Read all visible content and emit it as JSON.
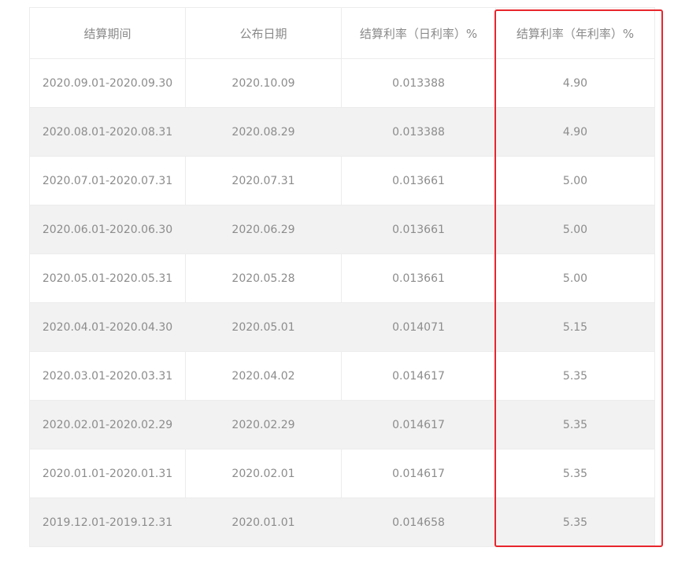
{
  "table": {
    "headers": [
      "结算期间",
      "公布日期",
      "结算利率（日利率）%",
      "结算利率（年利率）%"
    ],
    "rows": [
      [
        "2020.09.01-2020.09.30",
        "2020.10.09",
        "0.013388",
        "4.90"
      ],
      [
        "2020.08.01-2020.08.31",
        "2020.08.29",
        "0.013388",
        "4.90"
      ],
      [
        "2020.07.01-2020.07.31",
        "2020.07.31",
        "0.013661",
        "5.00"
      ],
      [
        "2020.06.01-2020.06.30",
        "2020.06.29",
        "0.013661",
        "5.00"
      ],
      [
        "2020.05.01-2020.05.31",
        "2020.05.28",
        "0.013661",
        "5.00"
      ],
      [
        "2020.04.01-2020.04.30",
        "2020.05.01",
        "0.014071",
        "5.15"
      ],
      [
        "2020.03.01-2020.03.31",
        "2020.04.02",
        "0.014617",
        "5.35"
      ],
      [
        "2020.02.01-2020.02.29",
        "2020.02.29",
        "0.014617",
        "5.35"
      ],
      [
        "2020.01.01-2020.01.31",
        "2020.02.01",
        "0.014617",
        "5.35"
      ],
      [
        "2019.12.01-2019.12.31",
        "2020.01.01",
        "0.014658",
        "5.35"
      ]
    ]
  },
  "highlight": {
    "color": "#e8262c",
    "column_index": 3
  },
  "colors": {
    "text": "#8c8c8c",
    "stripe": "#f2f2f2",
    "border": "#ececec"
  }
}
